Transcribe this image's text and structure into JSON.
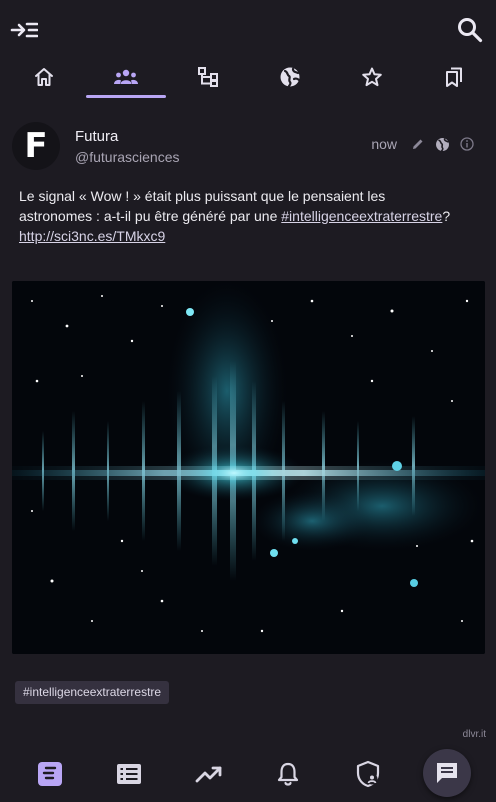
{
  "colors": {
    "background": "#1d1b22",
    "accent": "#b9a6f5",
    "icon": "#d9d6e3",
    "muted": "#a9a5b4"
  },
  "topbar": {
    "exit_icon": "exit-menu-icon",
    "search_icon": "search-icon"
  },
  "tabs": [
    {
      "icon": "home-icon",
      "active": false
    },
    {
      "icon": "people-icon",
      "active": true
    },
    {
      "icon": "sitemap-icon",
      "active": false
    },
    {
      "icon": "globe-icon",
      "active": false
    },
    {
      "icon": "star-icon",
      "active": false
    },
    {
      "icon": "bookmarks-icon",
      "active": false
    }
  ],
  "post": {
    "avatar_letter": "F",
    "display_name": "Futura",
    "handle": "@futurasciences",
    "time": "now",
    "text_before": "Le signal « Wow ! » était plus puissant que le pensaient les astronomes : a-t-il pu être généré par une ",
    "hashtag_link": "#intelligenceextraterrestre",
    "text_middle": "? ",
    "url": "http://sci3nc.es/TMkxc9",
    "tag_chip": "#intelligenceextraterrestre",
    "source": "dlvr.it"
  },
  "bottom_nav": [
    {
      "icon": "timeline-icon",
      "active": true
    },
    {
      "icon": "lists-icon",
      "active": false
    },
    {
      "icon": "trending-icon",
      "active": false
    },
    {
      "icon": "notifications-icon",
      "active": false
    },
    {
      "icon": "shield-account-icon",
      "active": false
    }
  ],
  "compose_icon": "compose-message-icon"
}
